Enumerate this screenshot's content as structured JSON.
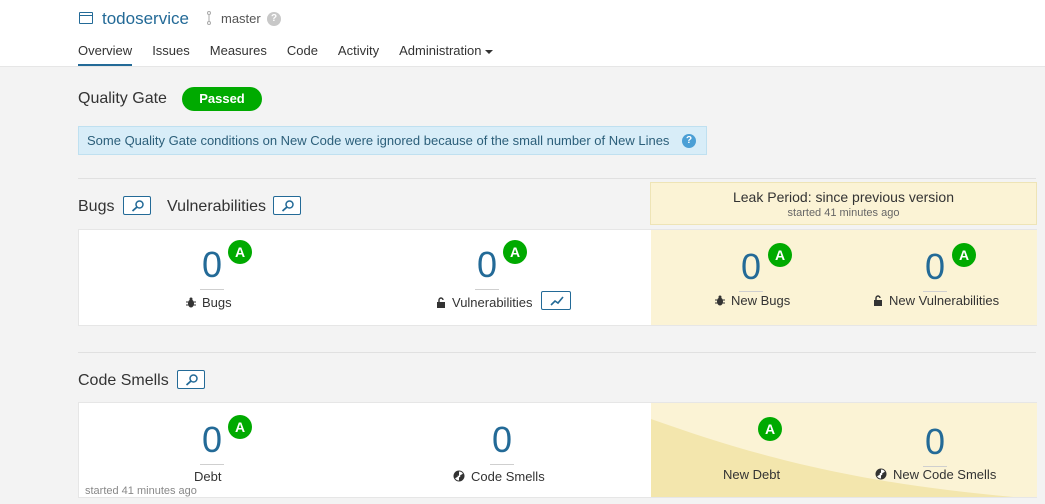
{
  "header": {
    "project_name": "todoservice",
    "branch": "master",
    "help_glyph": "?",
    "nav": [
      "Overview",
      "Issues",
      "Measures",
      "Code",
      "Activity",
      "Administration"
    ]
  },
  "quality_gate": {
    "title": "Quality Gate",
    "status": "Passed",
    "status_color": "#00aa00",
    "notice": "Some Quality Gate conditions on New Code were ignored because of the small number of New Lines",
    "notice_help": "?"
  },
  "leak_period": {
    "title": "Leak Period: since previous version",
    "subtitle": "started 41 minutes ago",
    "background": "#fbf3d5"
  },
  "bugs_vulns": {
    "bugs_title": "Bugs",
    "vulns_title": "Vulnerabilities",
    "bugs": {
      "value": "0",
      "rating": "A",
      "label": "Bugs",
      "icon": "bug-icon"
    },
    "vulnerabilities": {
      "value": "0",
      "rating": "A",
      "label": "Vulnerabilities",
      "icon": "lock-icon"
    },
    "new_bugs": {
      "value": "0",
      "rating": "A",
      "label": "New Bugs",
      "icon": "bug-icon"
    },
    "new_vulnerabilities": {
      "value": "0",
      "rating": "A",
      "label": "New Vulnerabilities",
      "icon": "lock-icon"
    }
  },
  "code_smells": {
    "title": "Code Smells",
    "debt": {
      "value": "0",
      "rating": "A",
      "label": "Debt"
    },
    "smells": {
      "value": "0",
      "label": "Code Smells",
      "icon": "radiation-icon"
    },
    "new_debt": {
      "rating": "A",
      "label": "New Debt"
    },
    "new_smells": {
      "value": "0",
      "label": "New Code Smells",
      "icon": "radiation-icon"
    },
    "started": "started 41 minutes ago"
  },
  "colors": {
    "accent": "#236a97",
    "rating_a": "#00aa00"
  }
}
